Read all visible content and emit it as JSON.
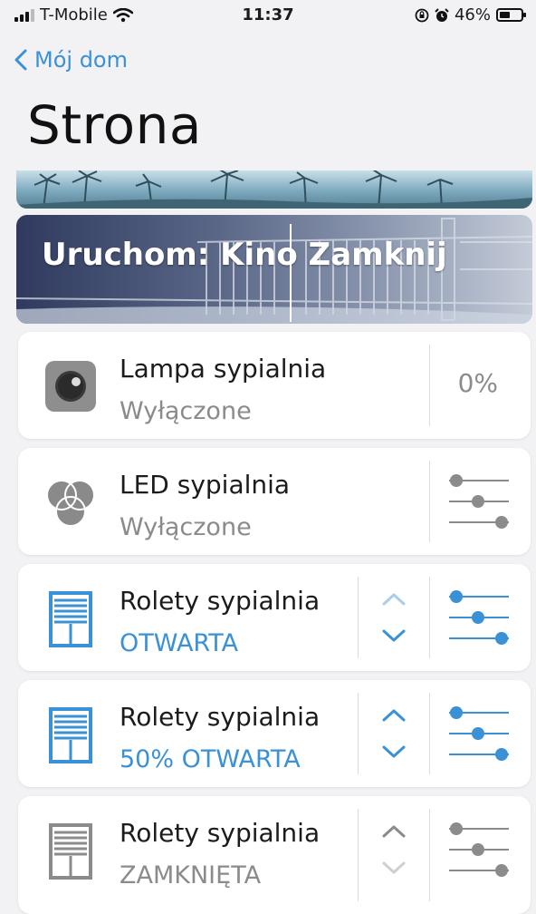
{
  "status_bar": {
    "carrier": "T-Mobile",
    "time": "11:37",
    "battery": "46%",
    "battery_level": 0.46
  },
  "nav": {
    "back_label": "Mój dom",
    "title": "Strona"
  },
  "scene": {
    "label": "Uruchom: Kino Zamknij"
  },
  "devices": [
    {
      "name": "Lampa sypialnia",
      "state": "Wyłączone",
      "value": "0%",
      "icon": "lamp-icon"
    },
    {
      "name": "LED sypialnia",
      "state": "Wyłączone",
      "icon": "rgb-led-icon"
    },
    {
      "name": "Rolety sypialnia",
      "state": "OTWARTA",
      "icon": "blinds-icon"
    },
    {
      "name": "Rolety sypialnia",
      "state": "50% OTWARTA",
      "icon": "blinds-icon"
    },
    {
      "name": "Rolety sypialnia",
      "state": "ZAMKNIĘTA",
      "icon": "blinds-icon"
    }
  ],
  "colors": {
    "accent": "#3a91d6",
    "inactive": "#8b8b8b",
    "background": "#f2f2f4"
  }
}
